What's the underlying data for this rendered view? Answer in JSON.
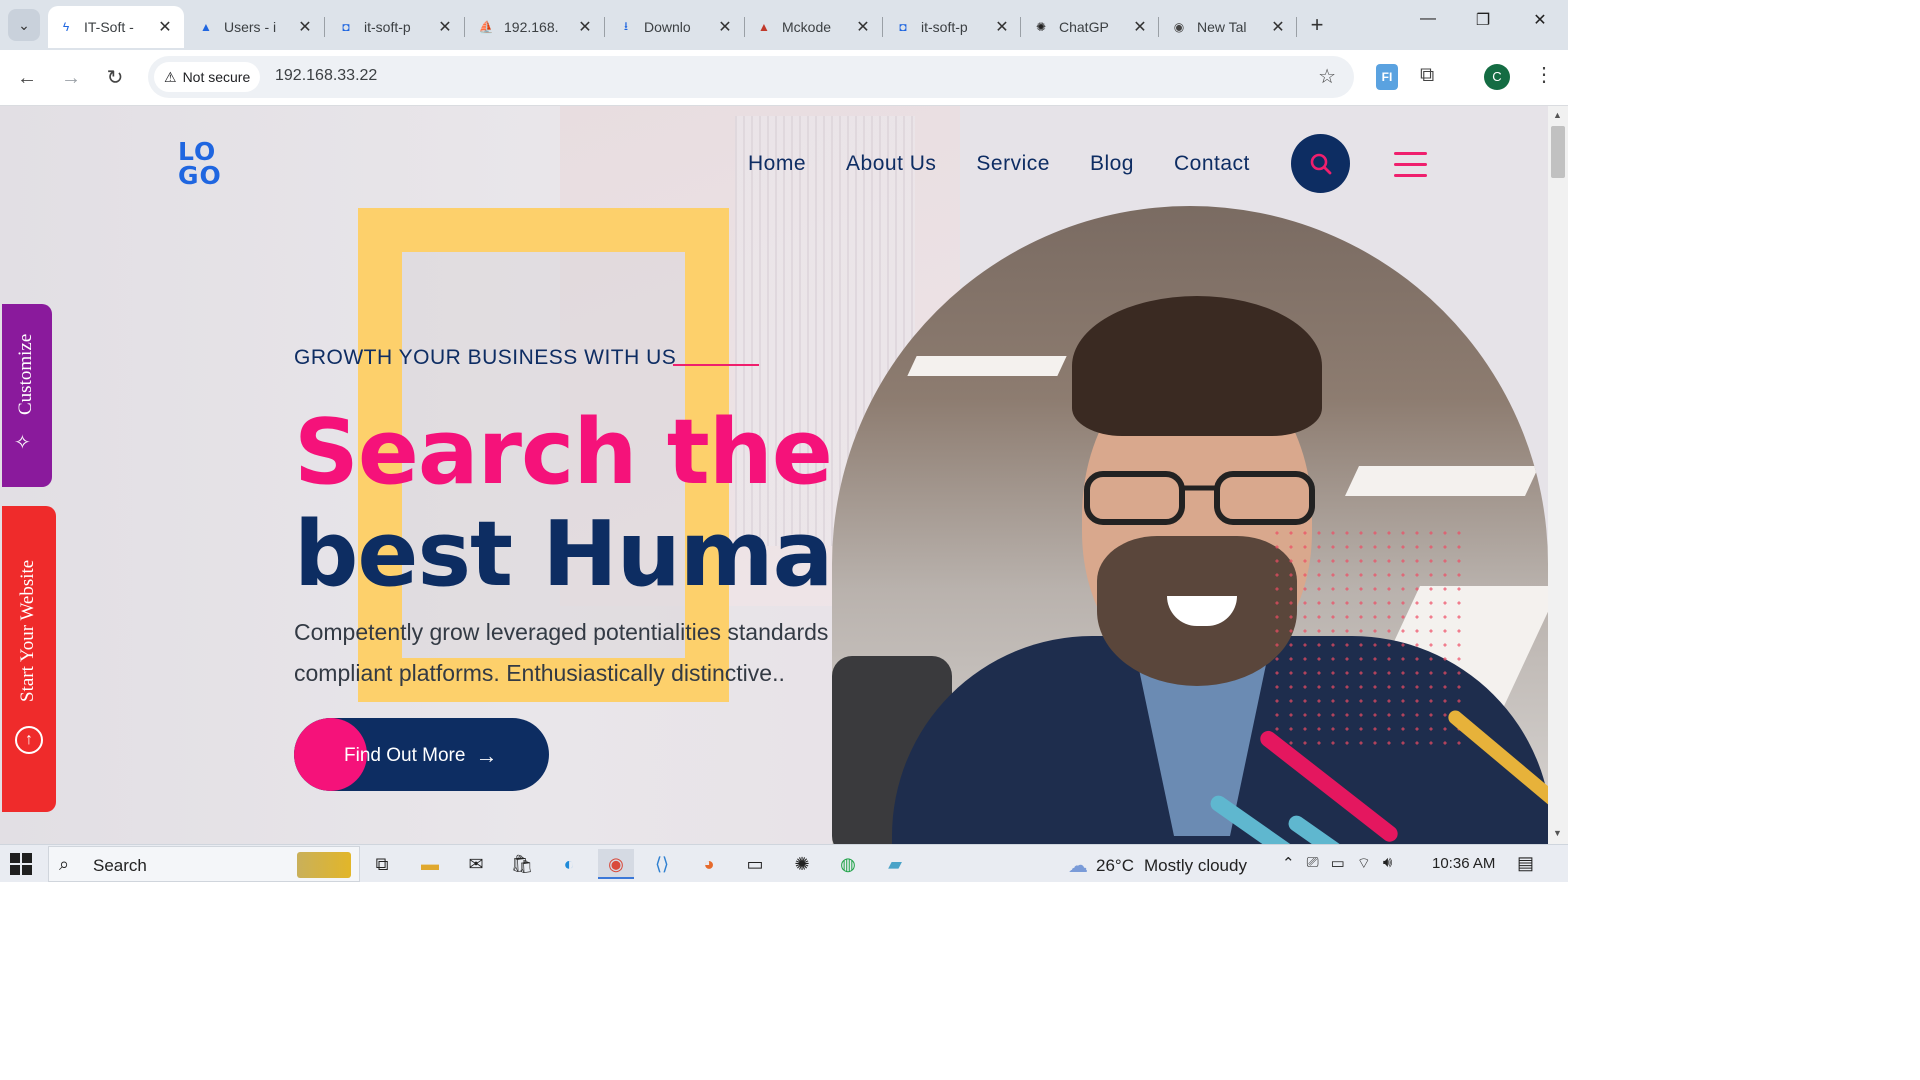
{
  "browser": {
    "tabs": [
      {
        "label": "IT-Soft -",
        "icon": "bolt-icon",
        "active": true
      },
      {
        "label": "Users - i",
        "icon": "azure-icon",
        "active": false
      },
      {
        "label": "it-soft-p",
        "icon": "shield-icon",
        "active": false
      },
      {
        "label": "192.168.",
        "icon": "pma-icon",
        "active": false
      },
      {
        "label": "Downlo",
        "icon": "download-icon",
        "active": false
      },
      {
        "label": "Mckode",
        "icon": "warning-icon",
        "active": false
      },
      {
        "label": "it-soft-p",
        "icon": "shield-icon",
        "active": false
      },
      {
        "label": "ChatGP",
        "icon": "chatgpt-icon",
        "active": false
      },
      {
        "label": "New Tal",
        "icon": "chrome-icon",
        "active": false
      }
    ],
    "security_label": "Not secure",
    "url": "192.168.33.22",
    "profile_initial": "C",
    "extension_label": "FI"
  },
  "site": {
    "logo": {
      "line1": "LO",
      "line2": "GO"
    },
    "nav": [
      "Home",
      "About Us",
      "Service",
      "Blog",
      "Contact"
    ],
    "tagline": "GROWTH YOUR BUSINESS WITH US",
    "headline_line1": "Search the",
    "headline_line2": "best Human",
    "description": "Competently grow leveraged potentialities standards compliant platforms. Enthusiastically distinctive..",
    "cta_label": "Find Out More",
    "side_customize": "Customize",
    "side_start": "Start Your Website",
    "colors": {
      "accent_pink": "#f5127a",
      "navy": "#0d2d62",
      "yellow": "#fdd06b",
      "purple_tab": "#8a1a9c",
      "red_tab": "#ef2b2b"
    }
  },
  "taskbar": {
    "search_placeholder": "Search",
    "apps": [
      "task-view-icon",
      "file-explorer-icon",
      "mail-icon",
      "store-icon",
      "edge-icon",
      "chrome-icon",
      "vscode-icon",
      "firefox-icon",
      "terminal-icon",
      "chatgpt-icon",
      "whatsapp-icon",
      "notepad-icon"
    ],
    "weather_temp": "26°C",
    "weather_desc": "Mostly cloudy",
    "time": "10:36 AM"
  }
}
